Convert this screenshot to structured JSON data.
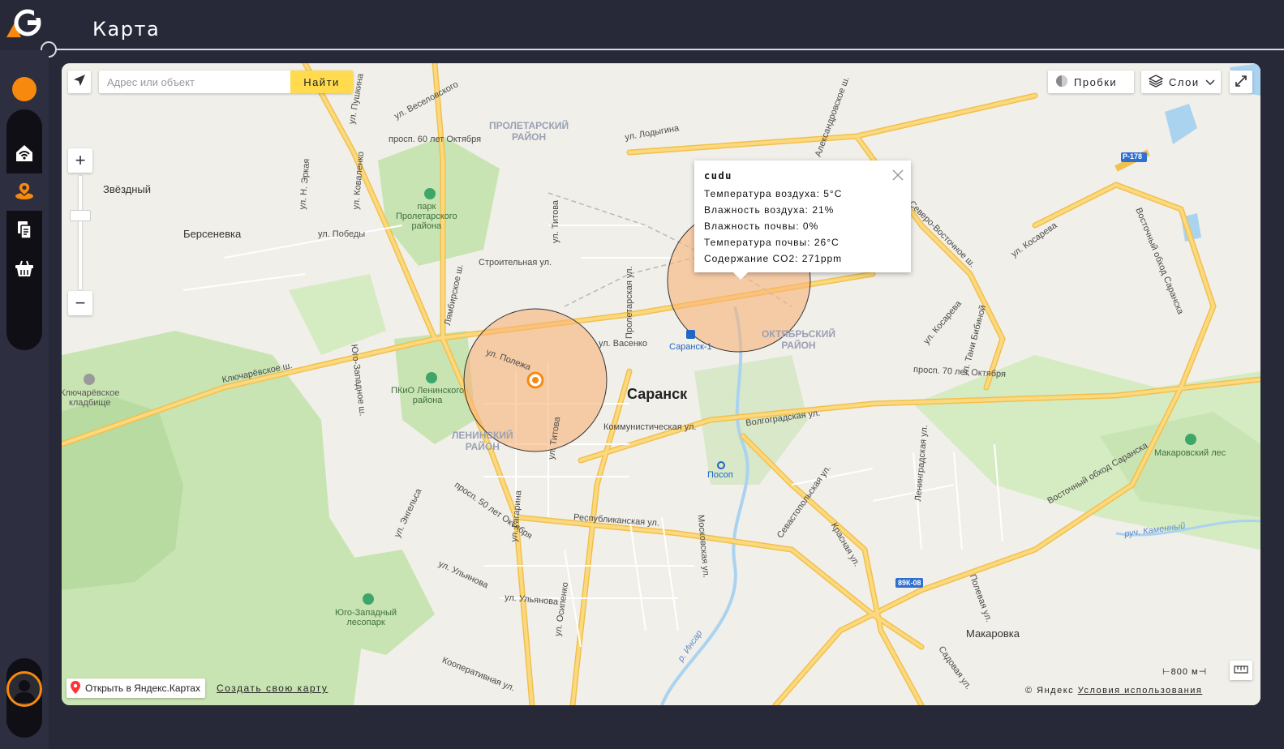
{
  "header": {
    "title": "Карта"
  },
  "sidebar": {
    "items": [
      {
        "icon": "wifi-home-icon",
        "active": false
      },
      {
        "icon": "map-pin-icon",
        "active": true
      },
      {
        "icon": "documents-icon",
        "active": false
      },
      {
        "icon": "basket-icon",
        "active": false
      }
    ],
    "accent": "#f7890f"
  },
  "map": {
    "search": {
      "placeholder": "Адрес или объект",
      "button": "Найти"
    },
    "controls": {
      "traffic": "Пробки",
      "layers": "Слои"
    },
    "zoom": {
      "plus": "+",
      "minus": "−"
    },
    "balloon": {
      "title": "cudu",
      "lines": [
        "Температура воздуха: 5°C",
        "Влажность воздуха: 21%",
        "Влажность почвы: 0%",
        "Температура почвы: 26°C",
        "Содержание CO2: 271ppm"
      ]
    },
    "footer": {
      "open_yandex": "Открыть в Яндекс.Картах",
      "create_map": "Создать свою карту",
      "scale": "800 м",
      "copyright": "© Яндекс",
      "terms": "Условия использования"
    },
    "labels": {
      "city": "Саранск",
      "district_proletarsky": "ПРОЛЕТАРСКИЙ\nРАЙОН",
      "district_oktyabrsky": "ОКТЯБРЬСКИЙ\nРАЙОН",
      "district_leninsky": "ЛЕНИНСКИЙ\nРАЙОН",
      "zvezdny": "Звёздный",
      "berseneevka": "Берсеневка",
      "makarovka": "Макаровка",
      "park_proletarsky": "парк\nПролетарского\nрайона",
      "pkio": "ПКиО Ленинского\nрайона",
      "lesopark": "Юго-Западный\nлесопарк",
      "makarovsky_les": "Макаровский лес",
      "cemetery": "Ключарёвское\nкладбище",
      "saransk1": "Саранск-1",
      "posop": "Посоп",
      "ul_veselovskogo": "ул. Веселовского",
      "prosp_60": "просп. 60 лет Октября",
      "ul_lodygina": "ул. Лодыгина",
      "ul_pobedy": "ул. Победы",
      "stroitelnaya": "Строительная ул.",
      "ul_titova": "ул. Титова",
      "ul_vasenko": "ул. Васенко",
      "kommunisticheskaya": "Коммунистическая ул.",
      "volgogradskaya": "Волгоградская ул.",
      "prosp_70": "просп. 70 лет Октября",
      "ul_kosareva": "ул. Косарева",
      "ul_kosareva2": "ул. Косарева",
      "klyucharevskoe": "Ключарёвское ш.",
      "respublikanskaya": "Республиканская ул.",
      "ul_ulyanova": "ул. Ульянова",
      "ul_ulyanova2": "ул. Ульянова",
      "ul_osipenko": "ул. Осипенко",
      "kooperativnaya": "Кооперативная ул.",
      "vostochny_obhod": "Восточный обход Саранска",
      "prosp_50": "просп. 50 лет Октября",
      "ul_polezhaeva": "ул. Полежа",
      "ul_titova2": "ул. Титова",
      "r178": "Р-178",
      "k89": "89К-08",
      "ruch_kamenny": "руч. Каменный",
      "insar": "р. Инсар",
      "ul_gagarina": "ул. Гагарина",
      "ul_engelsa": "ул. Энгельса",
      "sevastopolskaya": "Севастопольская ул.",
      "krasnaya": "Красная ул.",
      "leningradskaya": "Ленинградская ул.",
      "polevaya": "Полевая ул.",
      "sadovaya": "Садовая ул.",
      "severo_vostochnoe": "Северо-Восточное ш.",
      "vostochny_obhod2": "Восточный обход Саранска",
      "ul_tani_bibinoy": "ул. Тани Бибиной",
      "proletarskaya": "Пролетарская ул.",
      "moskovskaya": "Московская ул.",
      "lyambirskoe": "Лямбирское ш.",
      "yugo_zapadnoe": "Юго-Западное ш.",
      "ul_n_erkaya": "ул. Н. Эркая",
      "ul_kovalenko": "ул. Коваленко",
      "ul_pushkina": "ул. Пушкина",
      "aleksandrovskoe": "Александровское ш."
    },
    "colors": {
      "road": "#fcd97e",
      "road_edge": "#f1c04d",
      "park": "#c9e4b3",
      "water": "#aad3f0",
      "circle_fill": "#f8b27a",
      "marker": "#f7890f"
    }
  }
}
